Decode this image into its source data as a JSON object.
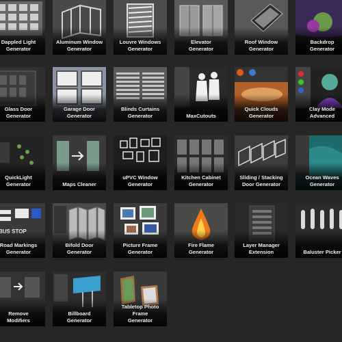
{
  "tools": [
    {
      "label": "Dappled Light\nGenerator",
      "icon": "dappled-light-thumbnail"
    },
    {
      "label": "Aluminum Window\nGenerator",
      "icon": "aluminum-window-thumbnail"
    },
    {
      "label": "Louvre Windows\nGenerator",
      "icon": "louvre-windows-thumbnail"
    },
    {
      "label": "Elevator\nGenerator",
      "icon": "elevator-thumbnail"
    },
    {
      "label": "Roof Window\nGenerator",
      "icon": "roof-window-thumbnail"
    },
    {
      "label": "Backdrop\nGenerator",
      "icon": "backdrop-thumbnail"
    },
    {
      "label": "Glass Door\nGenerator",
      "icon": "glass-door-thumbnail"
    },
    {
      "label": "Garage Door\nGenerator",
      "icon": "garage-door-thumbnail"
    },
    {
      "label": "Blinds Curtains\nGenerator",
      "icon": "blinds-curtains-thumbnail"
    },
    {
      "label": "MaxCutouts",
      "icon": "maxcutouts-thumbnail"
    },
    {
      "label": "Quick Clouds\nGenerator",
      "icon": "quick-clouds-thumbnail"
    },
    {
      "label": "Clay Mode\nAdvanced",
      "icon": "clay-mode-thumbnail"
    },
    {
      "label": "QuickLight\nGenerator",
      "icon": "quicklight-thumbnail"
    },
    {
      "label": "Maps Cleaner",
      "icon": "maps-cleaner-thumbnail"
    },
    {
      "label": "uPVC Window\nGenerator",
      "icon": "upvc-window-thumbnail"
    },
    {
      "label": "Kitchen Cabinet\nGenerator",
      "icon": "kitchen-cabinet-thumbnail"
    },
    {
      "label": "Sliding / Stacking\nDoor Generator",
      "icon": "sliding-door-thumbnail"
    },
    {
      "label": "Ocean Waves\nGenerator",
      "icon": "ocean-waves-thumbnail"
    },
    {
      "label": "Road Markings\nGenerator",
      "icon": "road-markings-thumbnail"
    },
    {
      "label": "Bifold Door\nGenerator",
      "icon": "bifold-door-thumbnail"
    },
    {
      "label": "Picture Frame\nGenerator",
      "icon": "picture-frame-thumbnail"
    },
    {
      "label": "Fire Flame\nGenerator",
      "icon": "fire-flame-thumbnail"
    },
    {
      "label": "Layer Manager\nExtension",
      "icon": "layer-manager-thumbnail"
    },
    {
      "label": "Baluster Picker",
      "icon": "baluster-picker-thumbnail"
    },
    {
      "label": "Remove\nModifiers",
      "icon": "remove-modifiers-thumbnail"
    },
    {
      "label": "Billboard\nGenerator",
      "icon": "billboard-thumbnail"
    },
    {
      "label": "Tabletop Photo Frame\nGenerator",
      "icon": "tabletop-frame-thumbnail"
    }
  ]
}
